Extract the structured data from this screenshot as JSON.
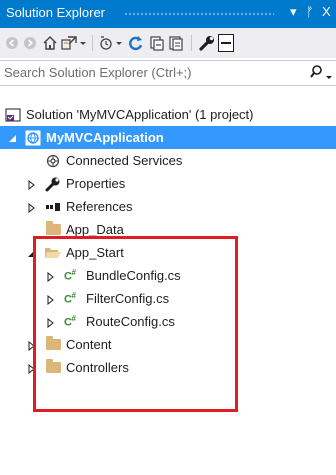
{
  "window": {
    "title": "Solution Explorer",
    "pin": "▾",
    "dock": "ᚠ",
    "close": "X"
  },
  "toolbar": {
    "icons": [
      "back-icon",
      "forward-icon",
      "home-icon",
      "sync-with-document-icon",
      "dropdown-icon",
      "pending-changes-icon",
      "dropdown-icon",
      "refresh-icon",
      "collapse-all-icon",
      "show-all-files-icon",
      "properties-wrench-icon",
      "preview-icon"
    ]
  },
  "search": {
    "placeholder": "Search Solution Explorer (Ctrl+;)"
  },
  "tree": {
    "solution": "Solution 'MyMVCApplication' (1 project)",
    "project": "MyMVCApplication",
    "connected_services": "Connected Services",
    "properties": "Properties",
    "references": "References",
    "app_data": "App_Data",
    "app_start": "App_Start",
    "bundle_config": "BundleConfig.cs",
    "filter_config": "FilterConfig.cs",
    "route_config": "RouteConfig.cs",
    "content": "Content",
    "controllers": "Controllers"
  },
  "colors": {
    "title_bar": "#007acc",
    "selected": "#3399ff",
    "highlight_box": "#e31b23",
    "folder": "#dcb67a",
    "csharp": "#388a34"
  }
}
